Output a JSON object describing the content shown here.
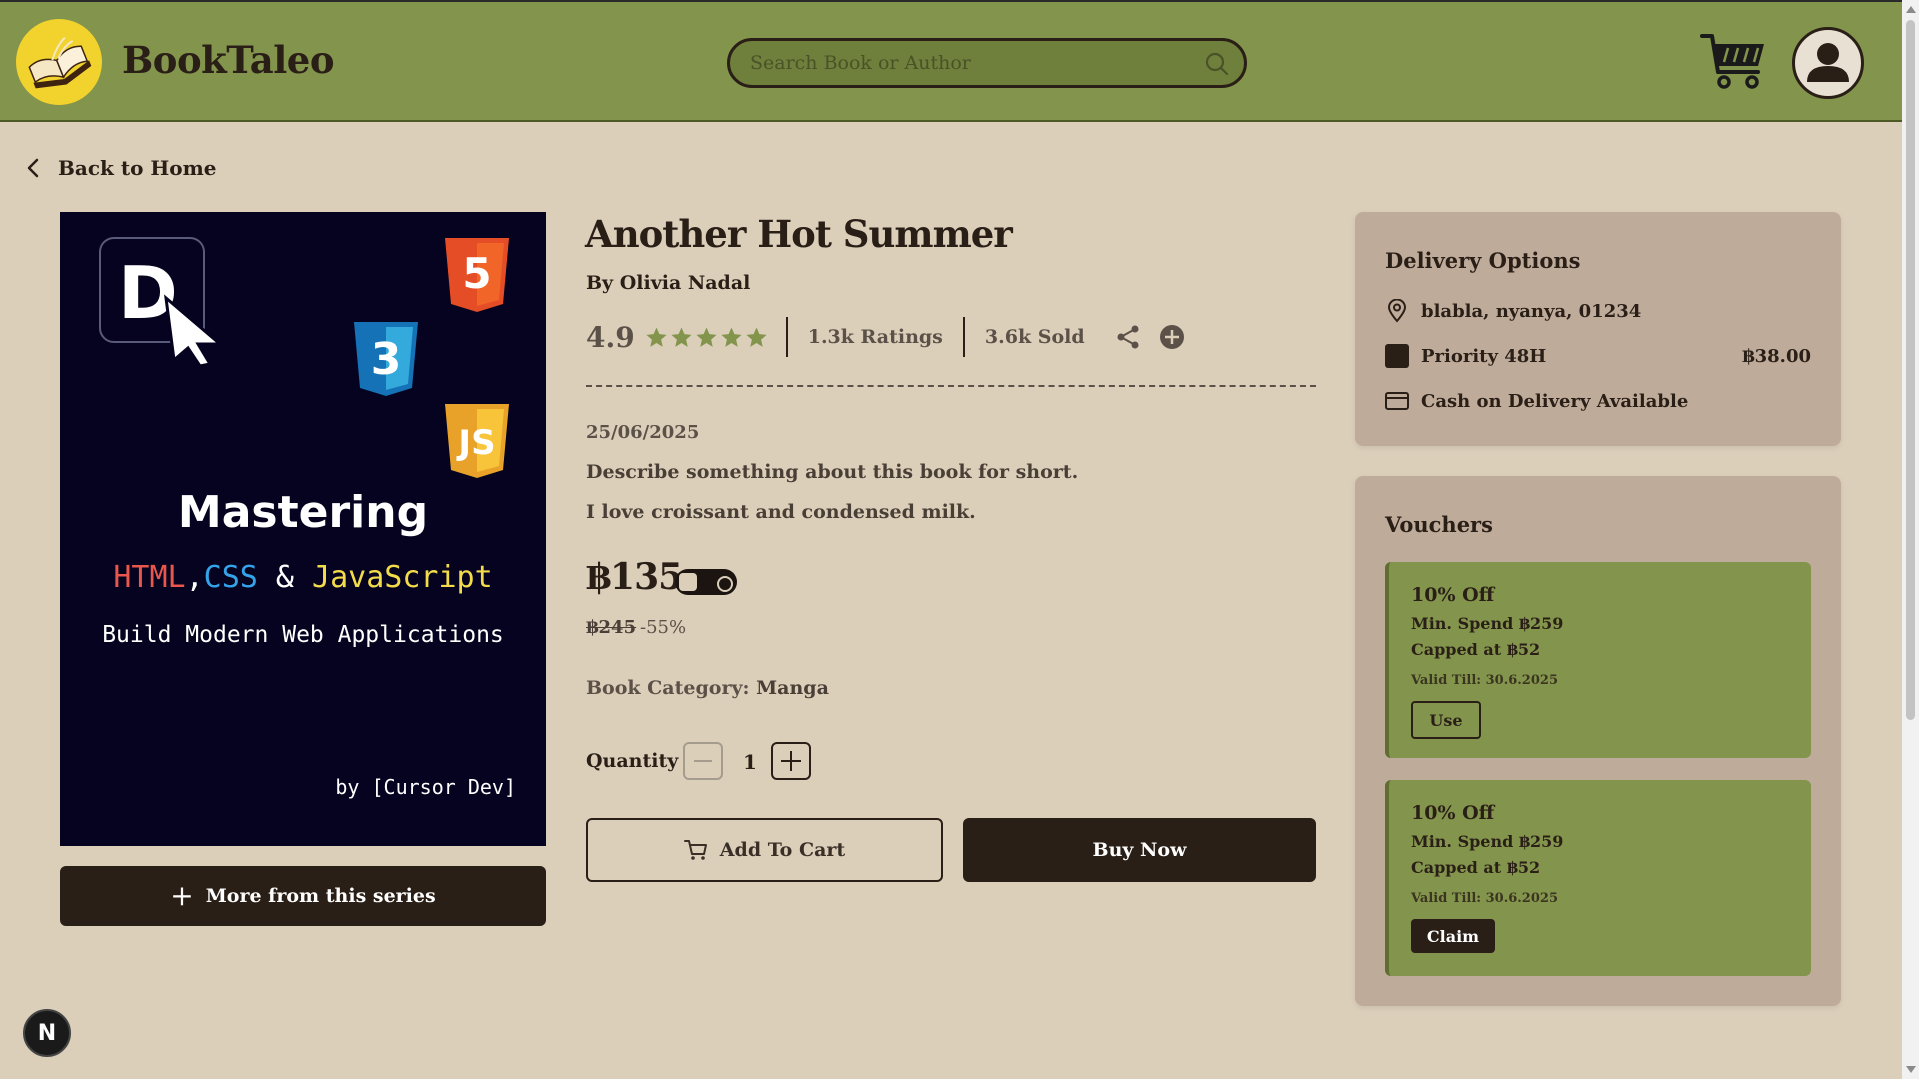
{
  "header": {
    "brand": "BookTaleo",
    "search_placeholder": "Search Book or Author"
  },
  "nav": {
    "back_label": "Back to Home"
  },
  "cover": {
    "title": "Mastering",
    "tech_html": "HTML",
    "tech_comma": ",",
    "tech_css": "CSS",
    "tech_amp": " & ",
    "tech_js": "JavaScript",
    "subtitle": "Build Modern Web Applications",
    "byline": "by [Cursor Dev]",
    "badge_d": "D",
    "badge_html": "5",
    "badge_css": "3",
    "badge_js": "JS"
  },
  "series_button": "More from this series",
  "book": {
    "title": "Another Hot Summer",
    "author": "By Olivia Nadal",
    "rating": "4.9",
    "stars": 5,
    "ratings_count": "1.3k Ratings",
    "sold": "3.6k Sold",
    "date": "25/06/2025",
    "desc1": "Describe something about this book for short.",
    "desc2": "I love croissant and condensed milk.",
    "price": "฿135",
    "old_price": "฿245",
    "discount": "-55%",
    "category_label": "Book Category: ",
    "category_value": "Manga",
    "quantity_label": "Quantity",
    "quantity": "1",
    "add_to_cart": "Add To Cart",
    "buy_now": "Buy Now"
  },
  "delivery": {
    "title": "Delivery Options",
    "address": "blabla, nyanya, 01234",
    "method": "Priority 48H",
    "method_price": "฿38.00",
    "payment": "Cash on Delivery Available"
  },
  "vouchers": {
    "title": "Vouchers",
    "items": [
      {
        "title": "10% Off",
        "min_spend": "Min. Spend ฿259",
        "cap": "Capped at ฿52",
        "valid": "Valid Till: 30.6.2025",
        "action": "Use"
      },
      {
        "title": "10% Off",
        "min_spend": "Min. Spend ฿259",
        "cap": "Capped at ฿52",
        "valid": "Valid Till: 30.6.2025",
        "action": "Claim"
      }
    ]
  },
  "dev_badge": "N",
  "colors": {
    "header_bg": "#83944c",
    "page_bg": "#dbcfba",
    "panel_bg": "#bfab9a",
    "dark": "#2a1f17",
    "star": "#83944c",
    "logo_bg": "#f2d32d"
  }
}
